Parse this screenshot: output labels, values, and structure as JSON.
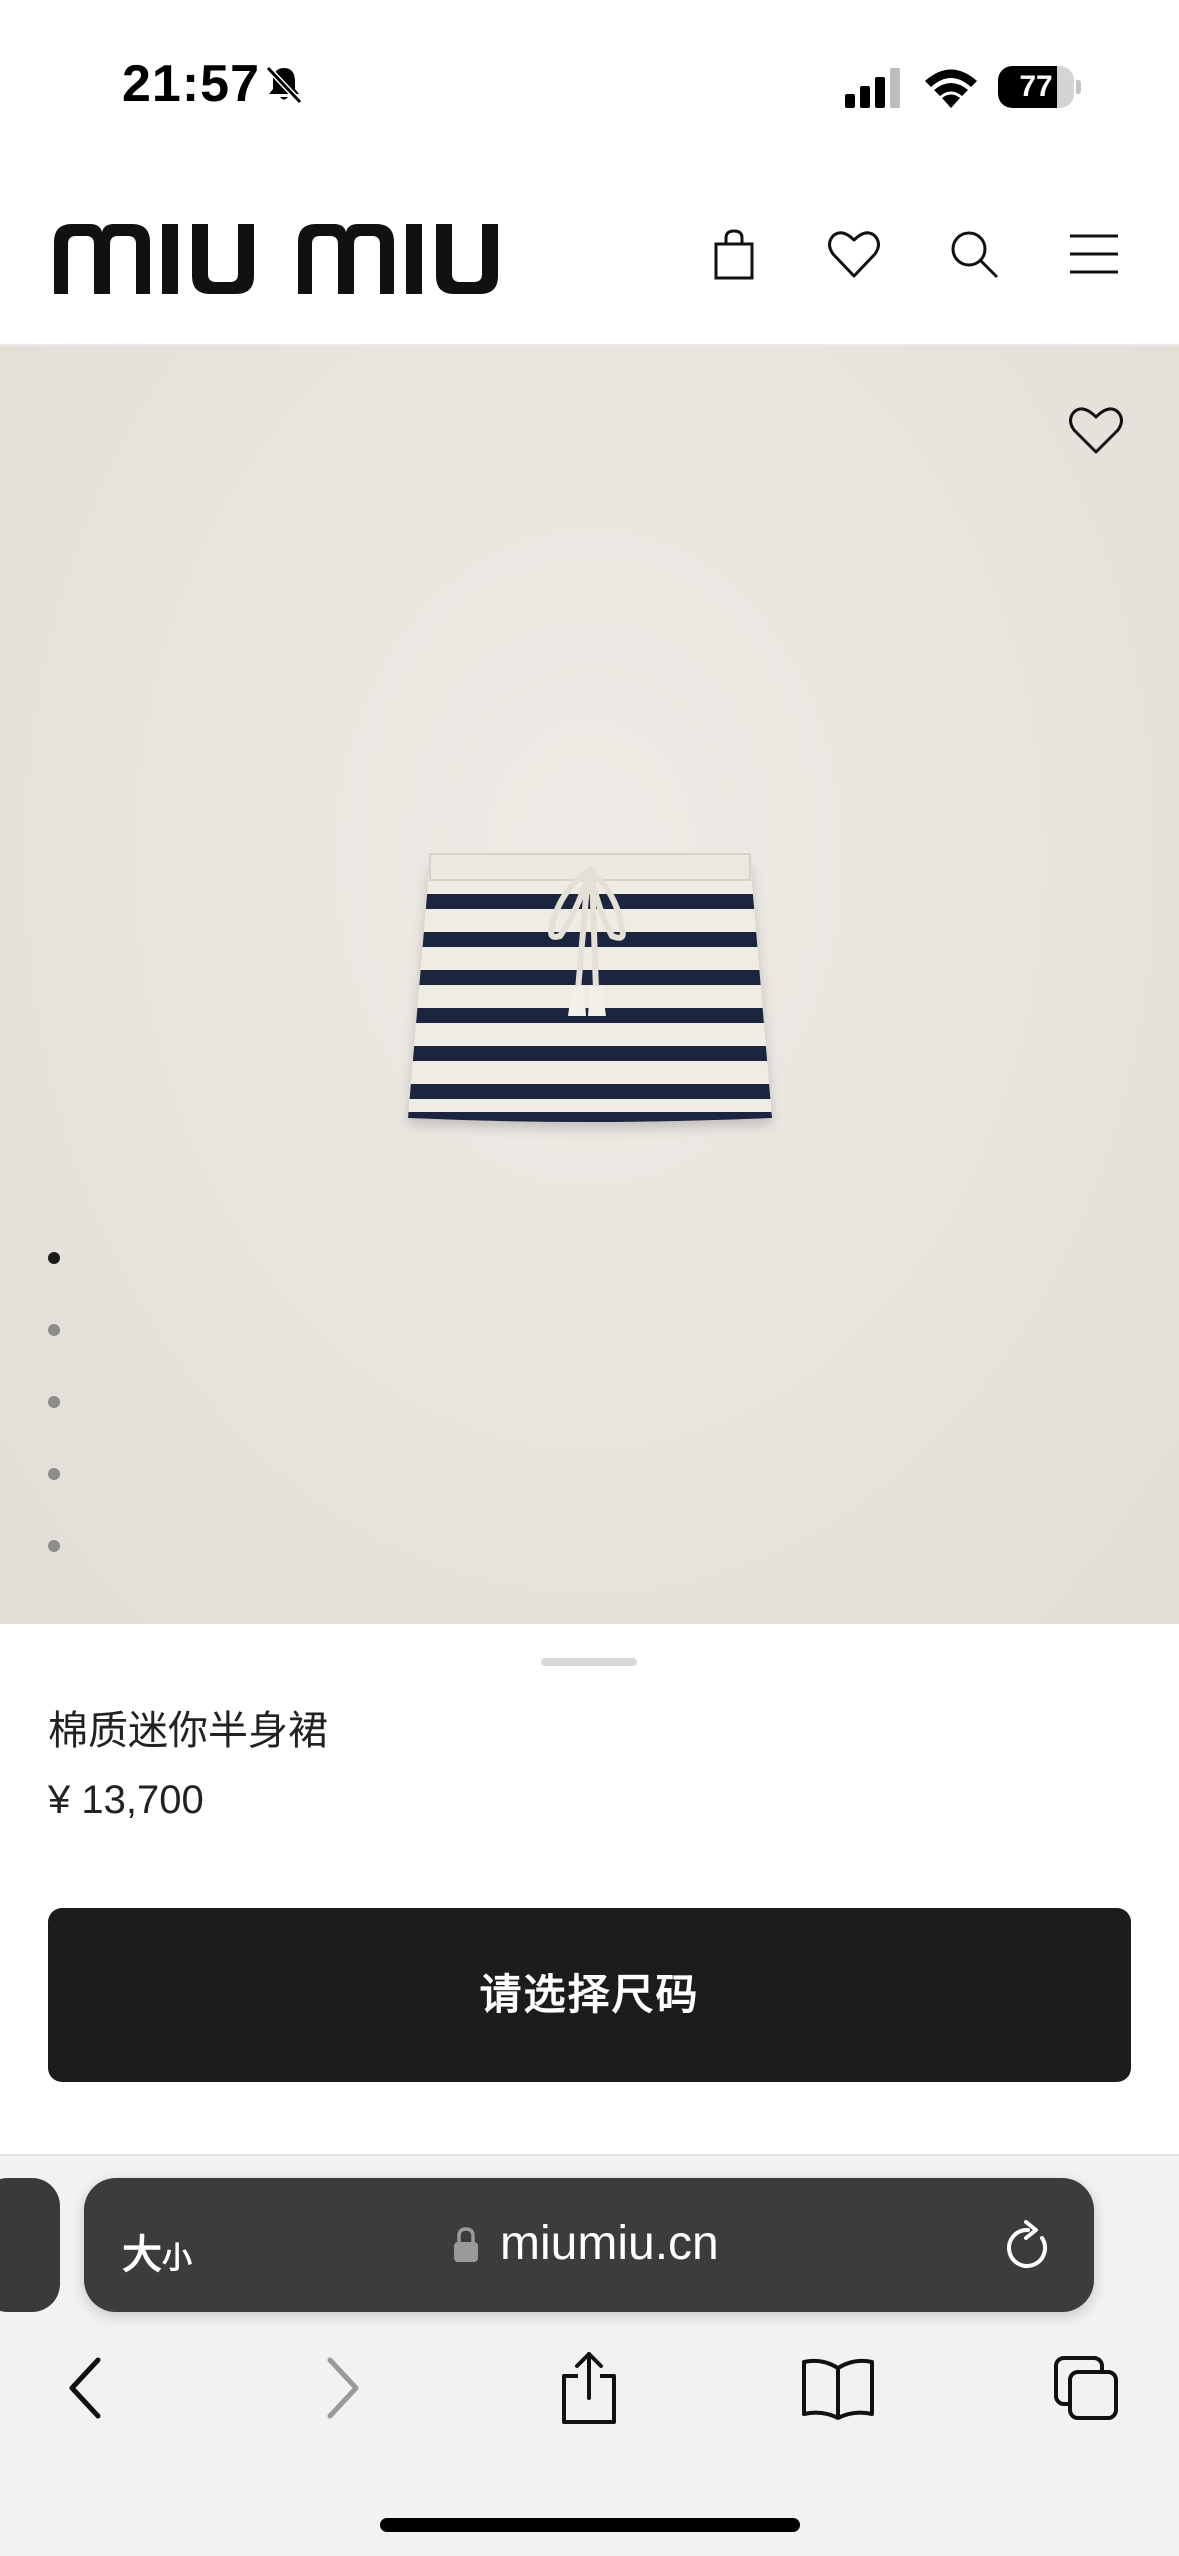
{
  "status_bar": {
    "time": "21:57",
    "battery_level": "77",
    "battery_fraction": 0.77,
    "icons": [
      "bell-slash-icon",
      "cellular-signal-icon",
      "wifi-icon",
      "battery-icon"
    ]
  },
  "header": {
    "logo_text": "miu miu",
    "icons": [
      "shopping-bag-icon",
      "heart-icon",
      "search-icon",
      "menu-icon"
    ]
  },
  "gallery": {
    "image_count": 5,
    "active_index": 0,
    "favorite_icon": "heart-icon"
  },
  "product": {
    "name": "棉质迷你半身裙",
    "price": "¥ 13,700",
    "cta_label": "请选择尺码"
  },
  "browser": {
    "aa_label": "大",
    "aa_small": "小",
    "url": "miumiu.cn",
    "toolbar_icons": [
      "back-icon",
      "forward-icon",
      "share-icon",
      "bookmarks-icon",
      "tabs-icon"
    ]
  },
  "colors": {
    "cta_background": "#1c1c1e",
    "hero_background": "#e6e2db",
    "skirt_stripe": "#1c2540",
    "skirt_cream": "#efece4"
  }
}
